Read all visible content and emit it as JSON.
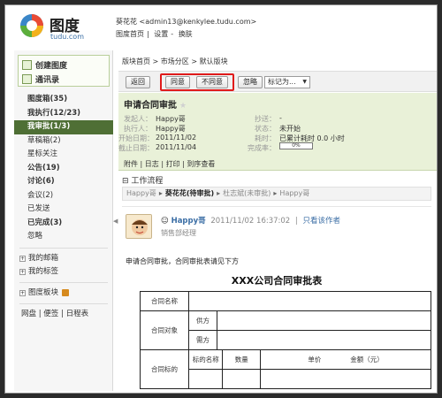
{
  "header": {
    "logo_text": "图度",
    "logo_sub": "tudu.com",
    "user_line": "葵花花 <admin13@kenkylee.tudu.com>",
    "links": [
      "图度首页",
      "|",
      "设置",
      "-",
      "换肤"
    ]
  },
  "sidebar": {
    "quick": {
      "create": "创建图度",
      "contacts": "通讯录"
    },
    "items": [
      {
        "label": "图度箱(35)",
        "bold": true,
        "active": false
      },
      {
        "label": "我执行(12/23)",
        "bold": true,
        "active": false
      },
      {
        "label": "我审批(1/3)",
        "bold": true,
        "active": true
      },
      {
        "label": "草稿箱(2)",
        "bold": false,
        "active": false
      },
      {
        "label": "星标关注",
        "bold": false,
        "active": false
      },
      {
        "label": "公告(19)",
        "bold": true,
        "active": false
      },
      {
        "label": "讨论(6)",
        "bold": true,
        "active": false
      },
      {
        "label": "会议(2)",
        "bold": false,
        "active": false
      },
      {
        "label": "已发送",
        "bold": false,
        "active": false
      },
      {
        "label": "已完成(3)",
        "bold": true,
        "active": false
      },
      {
        "label": "忽略",
        "bold": false,
        "active": false
      }
    ],
    "groups": {
      "mail": "我的邮箱",
      "tags": "我的标签",
      "board": "图度板块"
    },
    "footer": [
      "网盘",
      "|",
      "便签",
      "|",
      "日程表"
    ]
  },
  "main": {
    "breadcrumb": [
      "版块首页",
      ">",
      "市场分区",
      ">",
      "默认版块"
    ],
    "toolbar": {
      "back": "返回",
      "agree": "同意",
      "disagree": "不同意",
      "ignore": "忽略",
      "mark_as": "标记为..."
    },
    "task": {
      "title": "申请合同审批",
      "sender_label": "发起人：",
      "sender": "Happy哥",
      "executor_label": "执行人：",
      "executor": "Happy哥",
      "start_label": "开始日期：",
      "start": "2011/11/02",
      "end_label": "截止日期：",
      "end": "2011/11/04",
      "cc_label": "抄送：",
      "cc": "-",
      "status_label": "状态：",
      "status": "未开始",
      "time_label": "耗时：",
      "time": "已累计耗时 0.0 小时",
      "progress_label": "完成率：",
      "progress": "0%",
      "links": [
        "附件",
        "|",
        "日志",
        "|",
        "打印",
        "|",
        "到序查看"
      ]
    },
    "workflow": {
      "heading": "工作流程",
      "steps": [
        {
          "label": "Happy哥",
          "current": false
        },
        {
          "label": "葵花花(待审批)",
          "current": true
        },
        {
          "label": "杜志斌(未审批)",
          "current": false
        },
        {
          "label": "Happy哥",
          "current": false
        }
      ]
    },
    "post": {
      "author": "Happy哥",
      "date": "2011/11/02 16:37:02",
      "sep": "|",
      "only_author": "只看该作者",
      "role": "销售部经理",
      "intro": "申请合同审批，合同审批表请见下方",
      "doc_title": "XXX公司合同审批表",
      "table": {
        "contract_name": "合同名称",
        "parties": "合同对象",
        "party_a": "供方",
        "party_b": "需方",
        "subject": "合同标的",
        "subject_name": "标的名称",
        "qty": "数量",
        "unit_price": "单价",
        "amount": "金额（元）"
      }
    }
  }
}
